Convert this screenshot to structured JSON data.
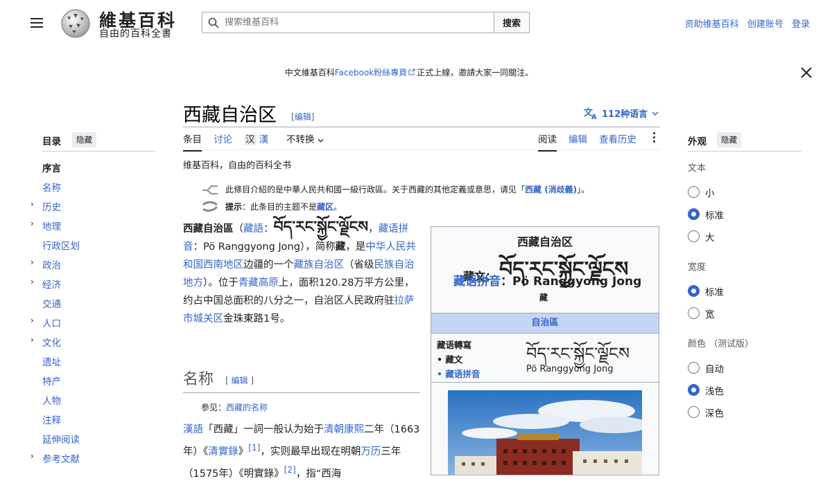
{
  "header": {
    "logo_title": "維基百科",
    "logo_tagline": "自由的百科全書",
    "search_placeholder": "搜索维基百科",
    "search_button": "搜索",
    "user_links": [
      "资助维基百科",
      "创建账号",
      "登录"
    ]
  },
  "banner": {
    "prefix": "中文維基百科",
    "link": "Facebook粉絲專頁",
    "suffix": "正式上線，邀請大家一同關注。"
  },
  "article": {
    "title": "西藏自治区",
    "title_edit": "编辑",
    "languages": "112种语言",
    "tabs_left": [
      "条目",
      "讨论"
    ],
    "variant_trad_simp": [
      "汉",
      "漢"
    ],
    "variant_dropdown": "不转换",
    "tabs_right": [
      "阅读",
      "编辑",
      "查看历史"
    ],
    "site_sub": "维基百科，自由的百科全书",
    "hatnote1_pre": "此條目介紹的是中華人民共和國一級行政區。关于西藏的其他定義或意思，请见「",
    "hatnote1_link": "西藏 (消歧義)",
    "hatnote1_post": "」。",
    "hatnote2_bold": "提示",
    "hatnote2_pre": "：此条目的主题不是",
    "hatnote2_link": "藏区",
    "hatnote2_post": "。",
    "section_heading": "名称",
    "section_edit": "编辑",
    "see_also_pre": "参见：",
    "see_also_link": "西藏的名称"
  },
  "toc": {
    "heading": "目录",
    "hide": "隐藏",
    "items": [
      "序言",
      "名称",
      "历史",
      "地理",
      "行政区划",
      "政治",
      "经济",
      "交通",
      "人口",
      "文化",
      "遗址",
      "特产",
      "人物",
      "注释",
      "延伸阅读",
      "参考文献"
    ]
  },
  "appearance": {
    "heading": "外观",
    "hide": "隐藏",
    "text_label": "文本",
    "text_options": [
      "小",
      "标准",
      "大"
    ],
    "text_selected": "标准",
    "width_label": "宽度",
    "width_options": [
      "标准",
      "宽"
    ],
    "width_selected": "标准",
    "color_label": "颜色 （测试版）",
    "color_options": [
      "自动",
      "浅色",
      "深色"
    ],
    "color_selected": "浅色"
  },
  "infobox": {
    "title": "西藏自治区",
    "tib_label": "藏文",
    "tib_script": "བོད་རང་སྐྱོང་ལྗོངས",
    "pinyin_label": "藏语拼音",
    "pinyin_value": "Pö Ranggyong Jong",
    "small_label": "藏",
    "band": "自治區",
    "row_head": "藏语轉寫",
    "row1": "• 藏文",
    "row2": "• 藏语拼音",
    "val_script": "བོད་རང་སྐྱོང་ལྗོངས",
    "val_latin": "Pö Ranggyong Jong"
  },
  "icons": [
    "menu-icon",
    "wikipedia-globe-icon",
    "search-icon",
    "external-link-icon",
    "close-icon",
    "translate-icon",
    "chevron-down-icon",
    "more-vertical-icon",
    "disambiguation-icon",
    "hatnote-info-icon",
    "chevron-right-icon"
  ]
}
